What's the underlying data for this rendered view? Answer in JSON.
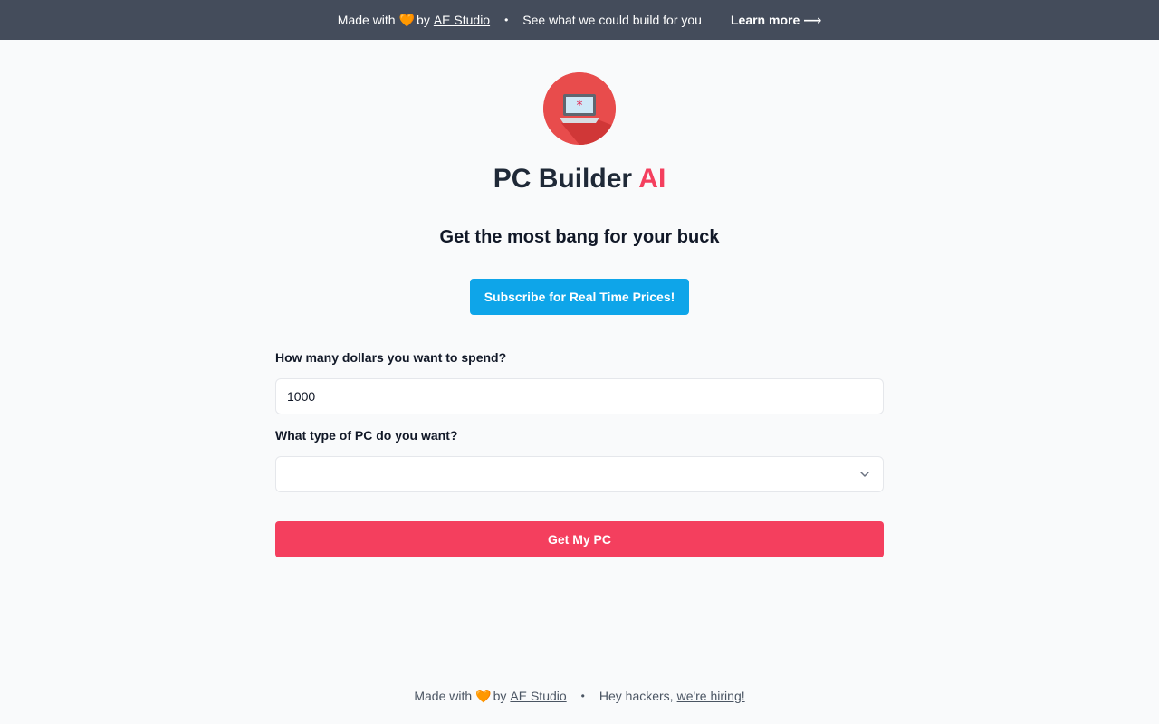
{
  "topbar": {
    "made_with": "Made with",
    "heart": "🧡",
    "by": "by",
    "studio_link": "AE Studio",
    "separator": "•",
    "tagline": "See what we could build for you",
    "learn_more": "Learn more ⟶"
  },
  "header": {
    "title_main": "PC Builder",
    "title_accent": "AI",
    "subtitle": "Get the most bang for your buck"
  },
  "subscribe_label": "Subscribe for Real Time Prices!",
  "form": {
    "budget_label": "How many dollars you want to spend?",
    "budget_value": "1000",
    "type_label": "What type of PC do you want?",
    "type_value": "",
    "submit_label": "Get My PC"
  },
  "footer": {
    "made_with": "Made with",
    "heart": "🧡",
    "by": "by",
    "studio_link": "AE Studio",
    "separator": "•",
    "hackers": "Hey hackers,",
    "hiring_link": "we're hiring!"
  },
  "colors": {
    "accent_pink": "#f43f5e",
    "subscribe_blue": "#0ea5e9",
    "topbar_bg": "#444c5b",
    "logo_red": "#e84c4c"
  },
  "icons": {
    "logo": "laptop-icon",
    "dropdown": "chevron-down-icon"
  }
}
